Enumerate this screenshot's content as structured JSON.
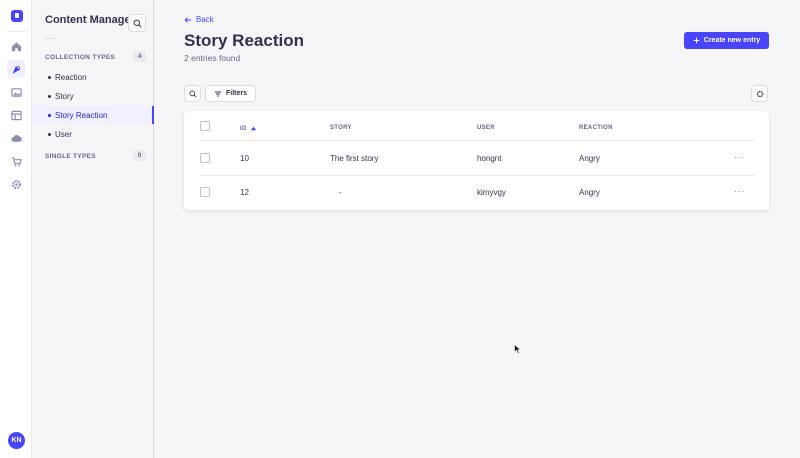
{
  "rail": {
    "avatar_initials": "KN",
    "items": [
      "home-icon",
      "content-manager-icon",
      "media-library-icon",
      "content-type-builder-icon",
      "cloud-icon",
      "marketplace-icon",
      "settings-icon"
    ]
  },
  "subnav": {
    "title": "Content Manager",
    "collection_types_label": "COLLECTION TYPES",
    "collection_types_count": "4",
    "collection_items": [
      {
        "label": "Reaction"
      },
      {
        "label": "Story"
      },
      {
        "label": "Story Reaction"
      },
      {
        "label": "User"
      }
    ],
    "single_types_label": "SINGLE TYPES",
    "single_types_count": "0"
  },
  "header": {
    "back_label": "Back",
    "title": "Story Reaction",
    "subtitle": "2 entries found",
    "create_label": "Create new entry"
  },
  "toolbar": {
    "filters_label": "Filters"
  },
  "table": {
    "columns": [
      "ID",
      "STORY",
      "USER",
      "REACTION"
    ],
    "rows": [
      {
        "id": "10",
        "story": "The first story",
        "user": "hongnt",
        "reaction": "Angry",
        "actions": "···"
      },
      {
        "id": "12",
        "story": "-",
        "user": "kimyvgy",
        "reaction": "Angry",
        "actions": "···"
      }
    ]
  },
  "colors": {
    "primary": "#4945ff",
    "text": "#32324d",
    "muted": "#666687",
    "background": "#f6f6f9"
  }
}
